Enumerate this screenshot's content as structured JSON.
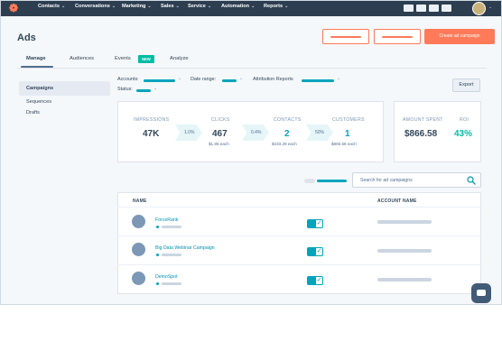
{
  "topnav": {
    "items": [
      "Contacts",
      "Conversations",
      "Marketing",
      "Sales",
      "Service",
      "Automation",
      "Reports"
    ]
  },
  "header": {
    "title": "Ads",
    "create_label": "Create ad campaign"
  },
  "tabs": {
    "items": [
      "Manage",
      "Audiences",
      "Events",
      "Analyze"
    ],
    "active": "Manage",
    "new_badge": "NEW"
  },
  "sidebar": {
    "items": [
      "Campaigns",
      "Sequences",
      "Drafts"
    ],
    "active": "Campaigns"
  },
  "filters": {
    "accounts_label": "Accounts:",
    "date_label": "Date range:",
    "attribution_label": "Attribution Reports",
    "status_label": "Status:",
    "export_label": "Export"
  },
  "stats": {
    "impressions_label": "IMPRESSIONS",
    "impressions_value": "47K",
    "rate1": "1.0%",
    "clicks_label": "CLICKS",
    "clicks_value": "467",
    "clicks_sub": "$1.86 each",
    "rate2": "0.4%",
    "contacts_label": "CONTACTS",
    "contacts_value": "2",
    "contacts_sub": "$433.29 each",
    "rate3": "50%",
    "customers_label": "CUSTOMERS",
    "customers_value": "1",
    "customers_sub": "$866.58 each",
    "amount_spent_label": "AMOUNT SPENT",
    "amount_spent_value": "$866.58",
    "roi_label": "ROI",
    "roi_value": "43%"
  },
  "search": {
    "placeholder": "Search for ad campaigns"
  },
  "table": {
    "headers": [
      "NAME",
      "ACCOUNT NAME"
    ],
    "rows": [
      {
        "name": "ForceRank"
      },
      {
        "name": "Big Data Webinar Campaign"
      },
      {
        "name": "DemoSpot"
      }
    ]
  },
  "colors": {
    "brand": "#ff7a59",
    "accent": "#00a4bd",
    "nav": "#2d3e50",
    "link": "#0091ae"
  }
}
